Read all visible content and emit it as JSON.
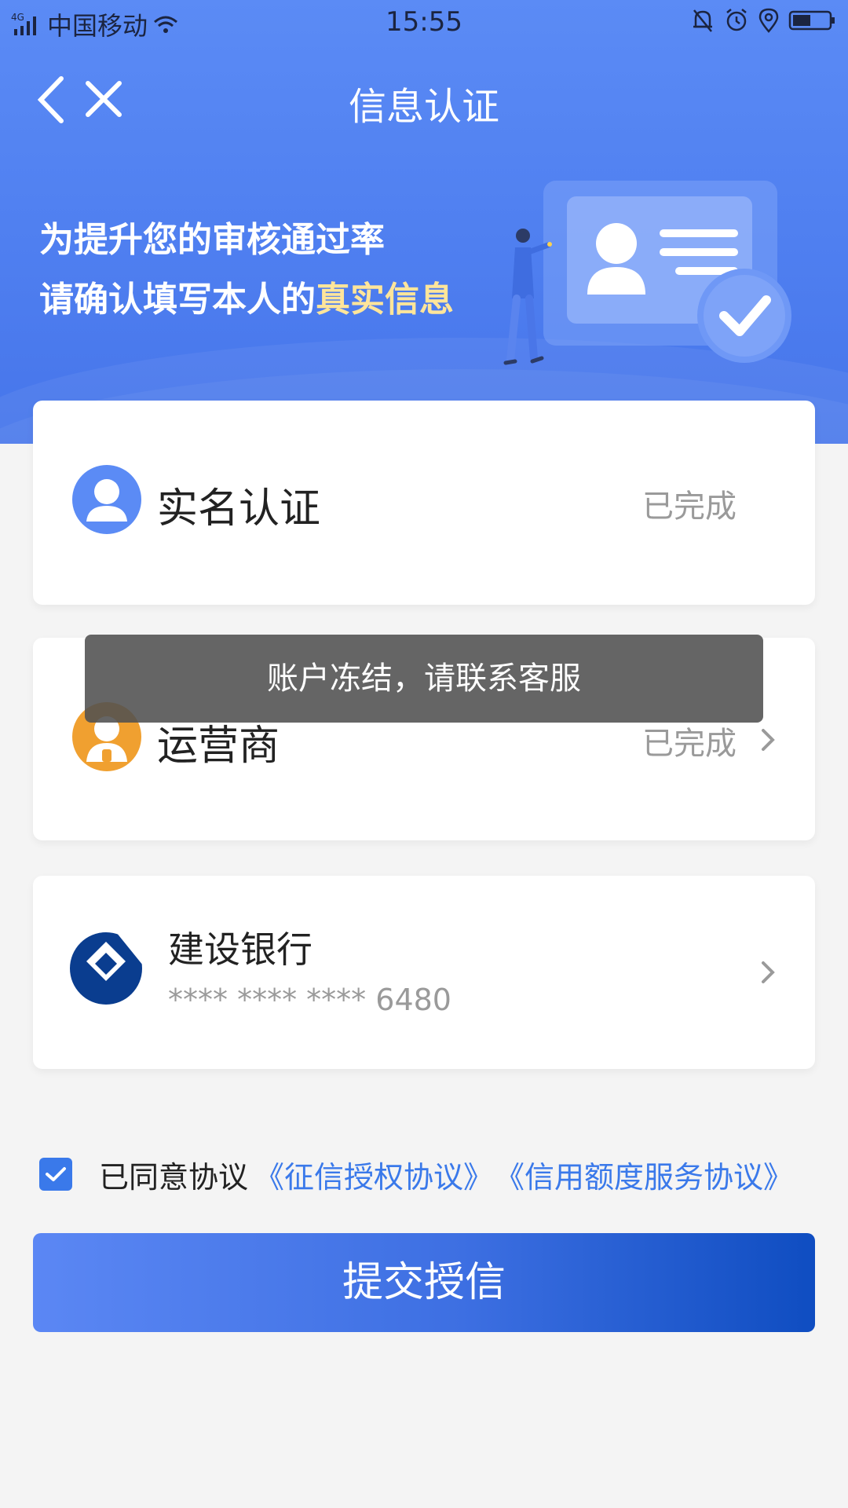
{
  "statusbar": {
    "network": "4G",
    "carrier": "中国移动",
    "time": "15:55"
  },
  "nav": {
    "title": "信息认证",
    "back_icon": "chevron-left-icon",
    "close_icon": "close-icon"
  },
  "banner": {
    "line1": "为提升您的审核通过率",
    "line2_prefix": "请确认填写本人的",
    "line2_highlight": "真实信息"
  },
  "cards": {
    "real_name": {
      "title": "实名认证",
      "status": "已完成"
    },
    "operator": {
      "title": "运营商",
      "status": "已完成"
    },
    "bank": {
      "name": "建设银行",
      "masked": "**** **** ****",
      "last4": "6480"
    }
  },
  "toast": {
    "text": "账户冻结，请联系客服"
  },
  "agreement": {
    "checked": true,
    "label": "已同意协议",
    "link1": "《征信授权协议》",
    "link2": "《信用额度服务协议》"
  },
  "submit": {
    "label": "提交授信"
  },
  "colors": {
    "primary": "#4f7ff0",
    "accent_yellow": "#ffe59a",
    "operator_orange": "#f0a030",
    "bank_blue": "#0a3d8f",
    "link": "#3a79ea"
  }
}
